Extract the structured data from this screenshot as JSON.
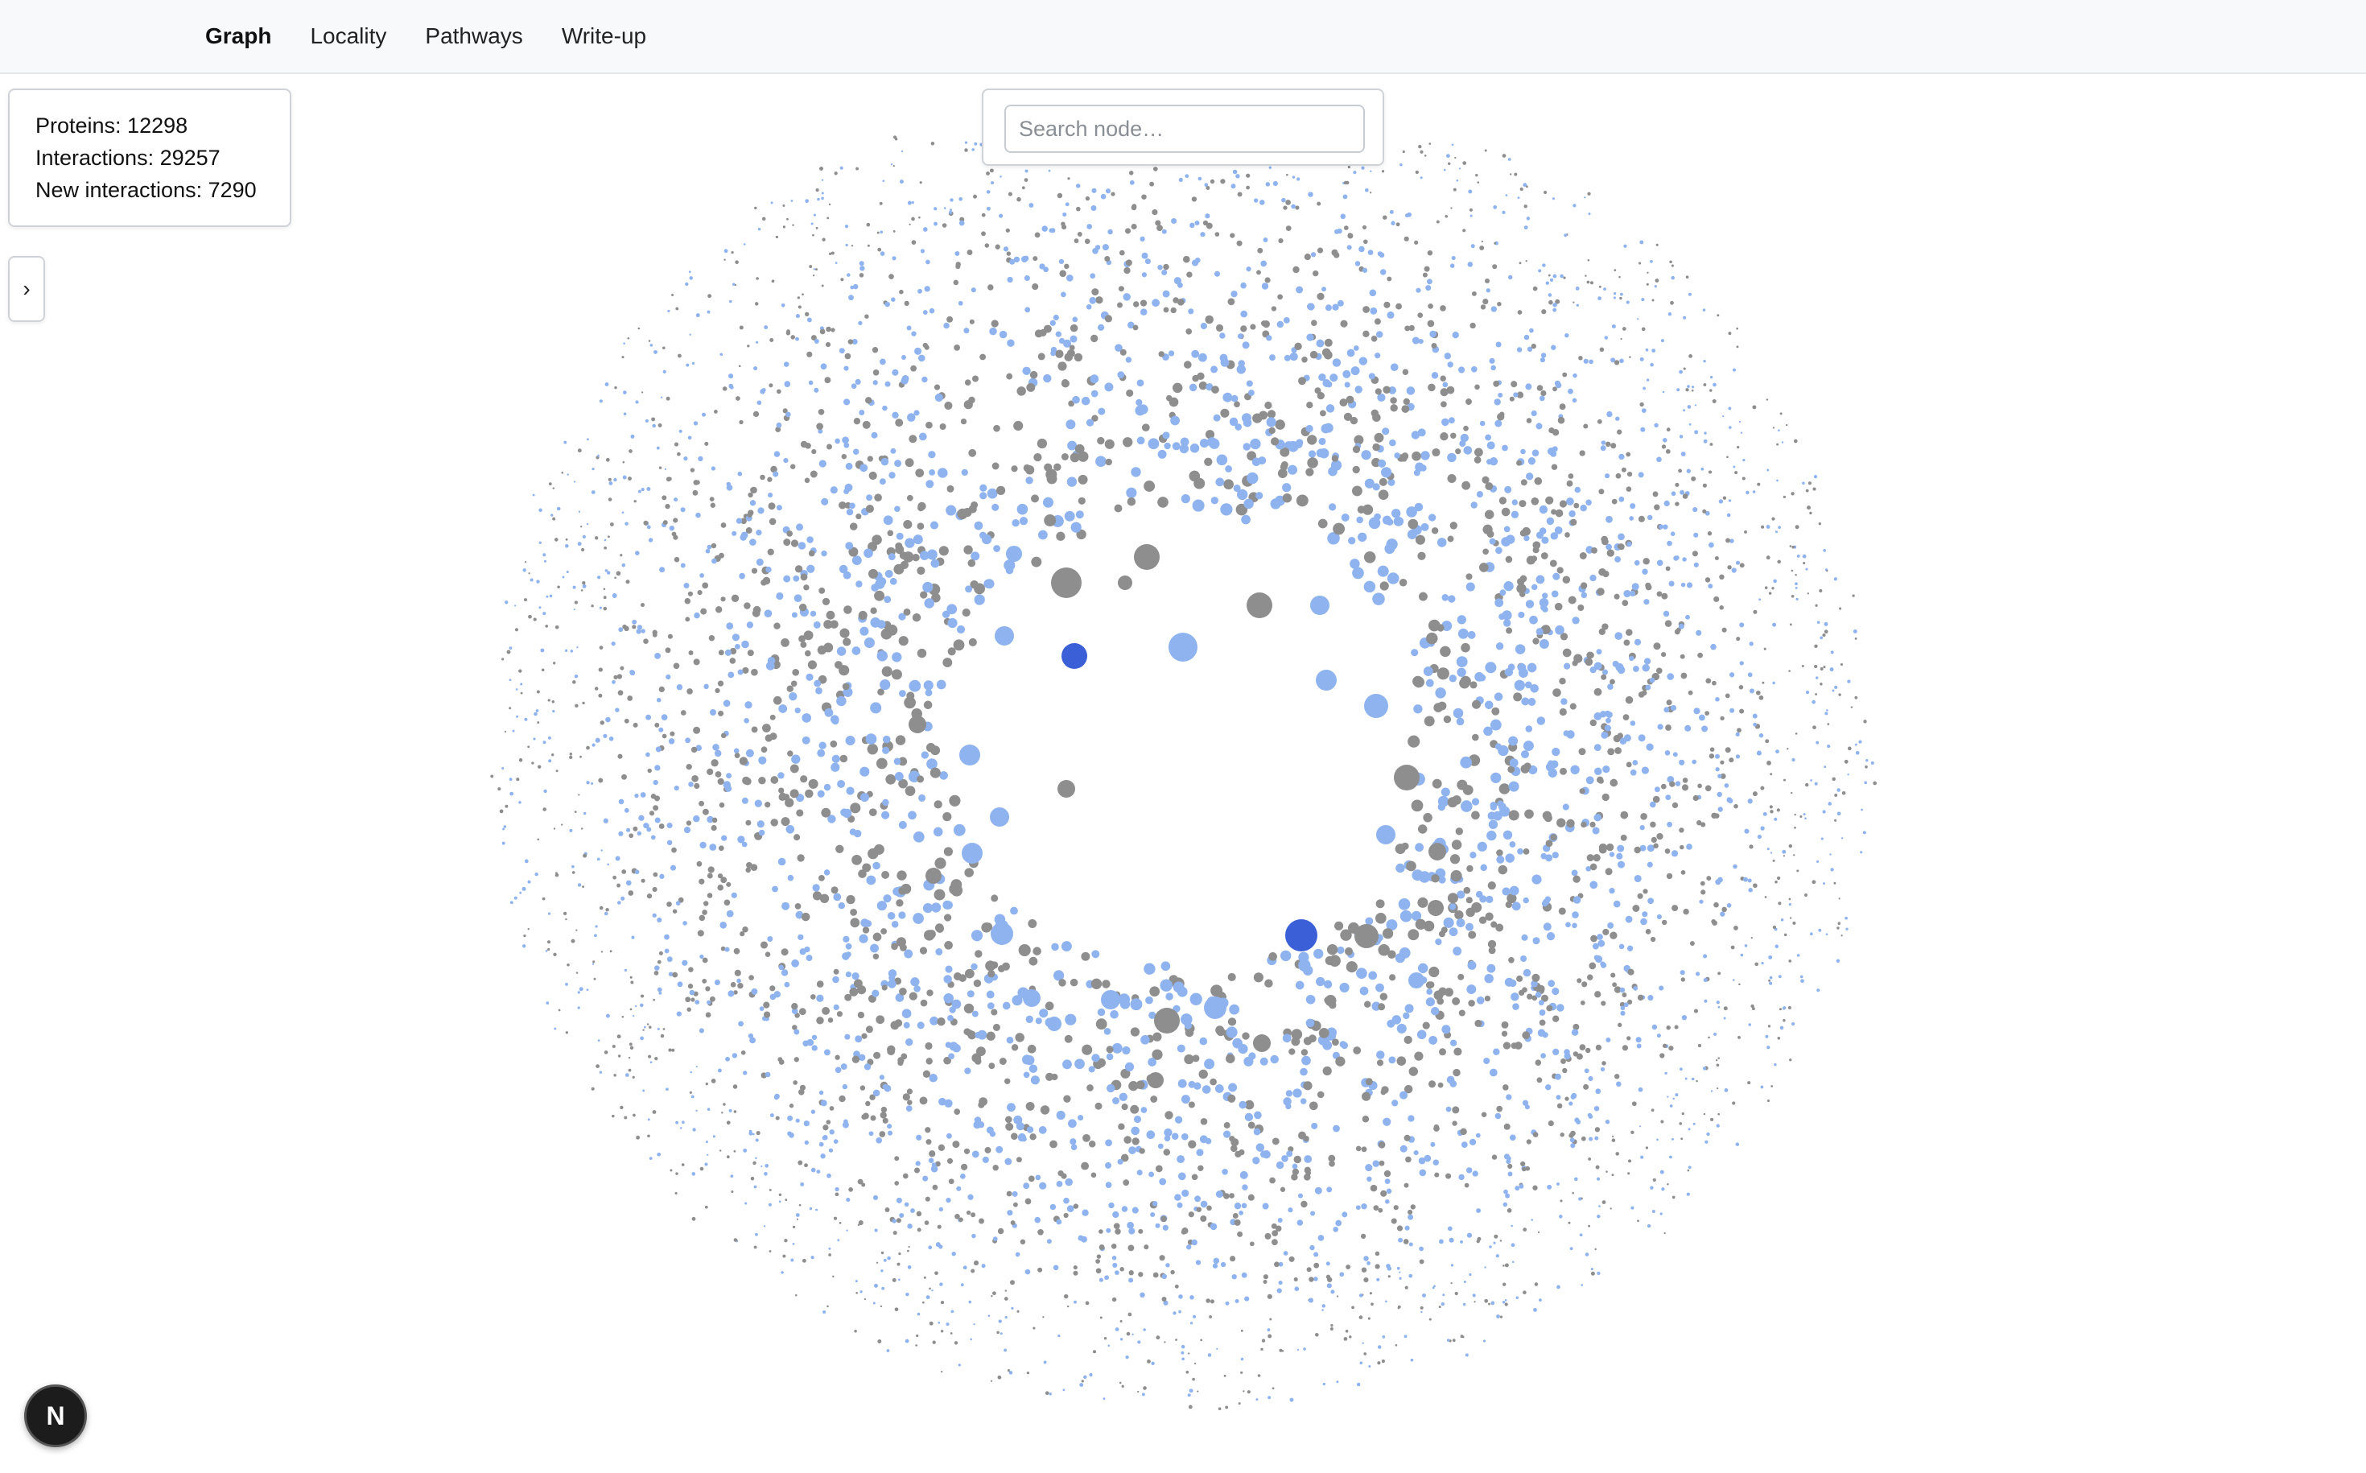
{
  "nav": {
    "items": [
      {
        "label": "Graph",
        "active": true
      },
      {
        "label": "Locality",
        "active": false
      },
      {
        "label": "Pathways",
        "active": false
      },
      {
        "label": "Write-up",
        "active": false
      }
    ]
  },
  "stats": {
    "proteins": "Proteins: 12298",
    "interactions": "Interactions: 29257",
    "new_interactions": "New interactions: 7290"
  },
  "sidebar_toggle": {
    "label": "›"
  },
  "search": {
    "placeholder": "Search node…",
    "value": ""
  },
  "graph": {
    "node_colors": {
      "known": "#8e8e8e",
      "new": "#8fb3ef",
      "highlighted": "#3a5fd6"
    }
  },
  "framework_badge": {
    "label": "N",
    "icon": "nextjs-icon"
  }
}
